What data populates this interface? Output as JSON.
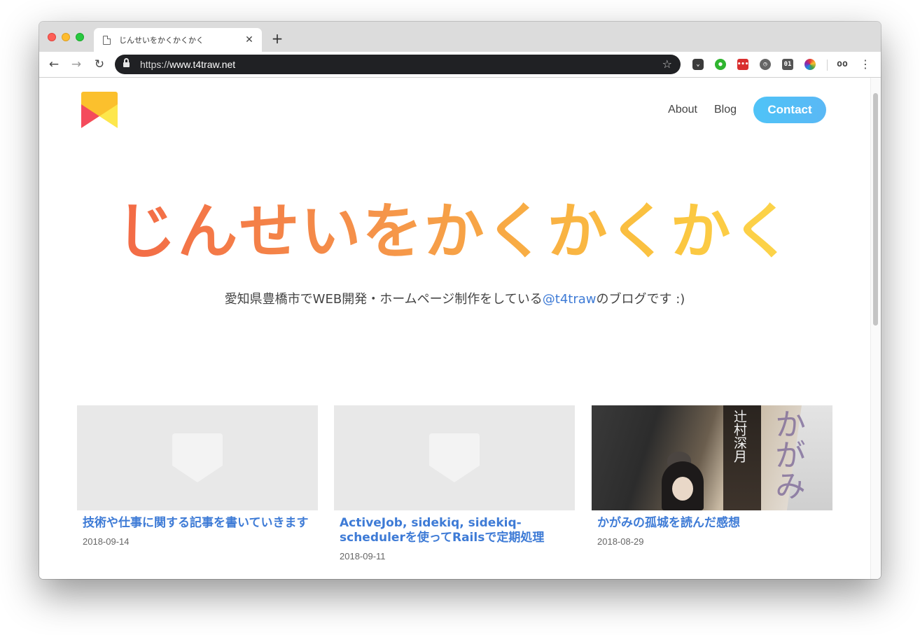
{
  "browser": {
    "tab_title": "じんせいをかくかくかく",
    "tab_close": "✕",
    "new_tab": "+",
    "url_scheme": "https://",
    "url_host": "www.t4traw.net",
    "ext_binary_label": "01",
    "ext_red_label": "•••"
  },
  "site": {
    "nav": {
      "about": "About",
      "blog": "Blog",
      "contact": "Contact"
    },
    "hero": {
      "title": "じんせいをかくかくかく",
      "subtitle_before": "愛知県豊橋市でWEB開発・ホームページ制作をしている",
      "handle": "@t4traw",
      "subtitle_after": "のブログです :)"
    },
    "posts": [
      {
        "title": "技術や仕事に関する記事を書いていきます",
        "date": "2018-09-14",
        "image": "placeholder"
      },
      {
        "title": "ActiveJob, sidekiq, sidekiq-schedulerを使ってRailsで定期処理",
        "date": "2018-09-11",
        "image": "placeholder"
      },
      {
        "title": "かがみの孤城を読んだ感想",
        "date": "2018-08-29",
        "image": "photo",
        "cover_author": "辻村深月",
        "cover_title": "かがみ"
      }
    ]
  },
  "colors": {
    "accent_link": "#3e7bd6",
    "contact_button": "#4fc3f7",
    "hero_gradient_start": "#f25d45",
    "hero_gradient_end": "#fde052"
  }
}
